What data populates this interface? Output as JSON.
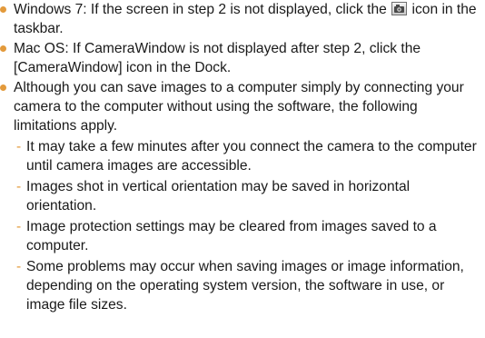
{
  "bullets": [
    {
      "text_before_icon": "Windows 7: If the screen in step 2 is not displayed, click the ",
      "icon_name": "camerawindow-taskbar-icon",
      "text_after_icon": " icon in the taskbar."
    },
    {
      "text": "Mac OS: If CameraWindow is not displayed after step 2, click the [CameraWindow] icon in the Dock."
    },
    {
      "text": "Although you can save images to a computer simply by connecting your camera to the computer without using the software, the following limitations apply.",
      "sub_items": [
        "It may take a few minutes after you connect the camera to the computer until camera images are accessible.",
        "Images shot in vertical orientation may be saved in horizontal orientation.",
        "Image protection settings may be cleared from images saved to a computer.",
        "Some problems may occur when saving images or image information, depending on the operating system version, the software in use, or image file sizes."
      ]
    }
  ],
  "dash_glyph": "-",
  "accent_color": "#e39a3b"
}
